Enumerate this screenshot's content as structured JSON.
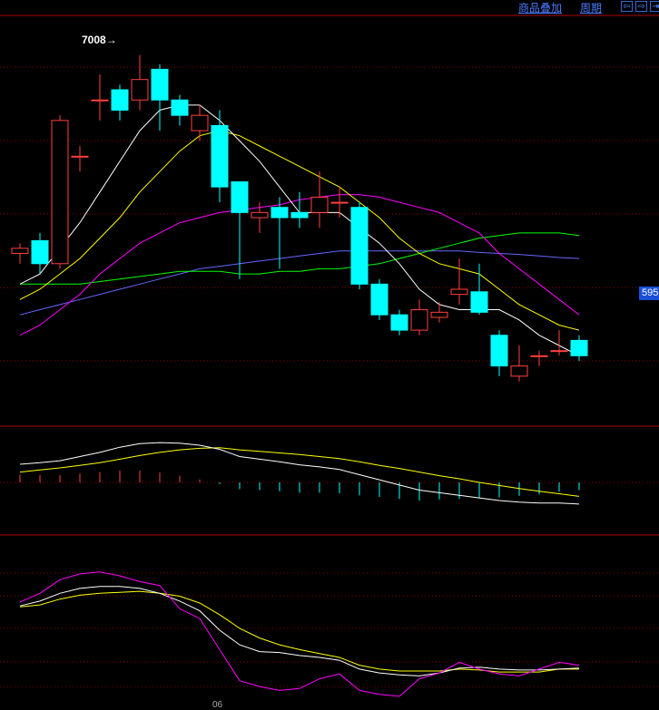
{
  "toolbar": {
    "overlay_label": "商品叠加",
    "period_label": "周期",
    "nav_prev": "⇦",
    "nav_next": "⇨",
    "nav_end": "⇥"
  },
  "price_tag": "595",
  "high_marker": "7008→",
  "x_tick": "06",
  "colors": {
    "up": "#ff4040",
    "down": "#00ffff",
    "ma5": "#ffffff",
    "ma10": "#ffff00",
    "ma20": "#ff00ff",
    "ma60": "#00ff00",
    "ma120": "#6666ff",
    "grid": "#8b0000",
    "border": "#b00000"
  },
  "chart_data": [
    {
      "type": "candlestick",
      "panel": "price",
      "candles": [
        {
          "o": 6620,
          "c": 6630,
          "h": 6640,
          "l": 6600
        },
        {
          "o": 6645,
          "c": 6600,
          "h": 6660,
          "l": 6580
        },
        {
          "o": 6600,
          "c": 6880,
          "h": 6890,
          "l": 6590
        },
        {
          "o": 6810,
          "c": 6810,
          "h": 6830,
          "l": 6780
        },
        {
          "o": 6920,
          "c": 6920,
          "h": 6970,
          "l": 6880
        },
        {
          "o": 6940,
          "c": 6900,
          "h": 6950,
          "l": 6880
        },
        {
          "o": 6920,
          "c": 6960,
          "h": 7008,
          "l": 6900
        },
        {
          "o": 6980,
          "c": 6920,
          "h": 6990,
          "l": 6860
        },
        {
          "o": 6920,
          "c": 6890,
          "h": 6930,
          "l": 6870
        },
        {
          "o": 6860,
          "c": 6890,
          "h": 6910,
          "l": 6840
        },
        {
          "o": 6870,
          "c": 6750,
          "h": 6900,
          "l": 6720
        },
        {
          "o": 6760,
          "c": 6700,
          "h": 6760,
          "l": 6570
        },
        {
          "o": 6690,
          "c": 6700,
          "h": 6720,
          "l": 6660
        },
        {
          "o": 6710,
          "c": 6690,
          "h": 6730,
          "l": 6590
        },
        {
          "o": 6700,
          "c": 6690,
          "h": 6740,
          "l": 6670
        },
        {
          "o": 6700,
          "c": 6730,
          "h": 6780,
          "l": 6670
        },
        {
          "o": 6720,
          "c": 6720,
          "h": 6750,
          "l": 6690
        },
        {
          "o": 6710,
          "c": 6560,
          "h": 6720,
          "l": 6550
        },
        {
          "o": 6560,
          "c": 6500,
          "h": 6570,
          "l": 6490
        },
        {
          "o": 6500,
          "c": 6470,
          "h": 6510,
          "l": 6460
        },
        {
          "o": 6470,
          "c": 6510,
          "h": 6530,
          "l": 6460
        },
        {
          "o": 6495,
          "c": 6505,
          "h": 6525,
          "l": 6485
        },
        {
          "o": 6540,
          "c": 6550,
          "h": 6610,
          "l": 6520
        },
        {
          "o": 6545,
          "c": 6505,
          "h": 6600,
          "l": 6500
        },
        {
          "o": 6460,
          "c": 6400,
          "h": 6470,
          "l": 6380
        },
        {
          "o": 6380,
          "c": 6400,
          "h": 6440,
          "l": 6370
        },
        {
          "o": 6420,
          "c": 6420,
          "h": 6430,
          "l": 6400
        },
        {
          "o": 6430,
          "c": 6430,
          "h": 6470,
          "l": 6420
        },
        {
          "o": 6450,
          "c": 6420,
          "h": 6460,
          "l": 6410
        }
      ],
      "ma5": [
        6560,
        6580,
        6630,
        6680,
        6740,
        6800,
        6860,
        6900,
        6910,
        6910,
        6880,
        6840,
        6800,
        6750,
        6700,
        6700,
        6700,
        6670,
        6640,
        6600,
        6550,
        6520,
        6510,
        6510,
        6510,
        6490,
        6460,
        6440,
        6420
      ],
      "ma10": [
        6530,
        6550,
        6580,
        6610,
        6650,
        6690,
        6740,
        6780,
        6820,
        6850,
        6860,
        6850,
        6830,
        6810,
        6790,
        6770,
        6750,
        6720,
        6690,
        6650,
        6620,
        6600,
        6590,
        6580,
        6550,
        6520,
        6500,
        6480,
        6470
      ],
      "ma20": [
        6460,
        6480,
        6510,
        6540,
        6580,
        6610,
        6640,
        6660,
        6680,
        6690,
        6700,
        6705,
        6710,
        6715,
        6725,
        6730,
        6735,
        6735,
        6730,
        6720,
        6710,
        6700,
        6680,
        6660,
        6620,
        6590,
        6560,
        6530,
        6500
      ],
      "ma60": [
        6560,
        6560,
        6560,
        6560,
        6565,
        6570,
        6575,
        6580,
        6585,
        6585,
        6585,
        6580,
        6580,
        6585,
        6585,
        6590,
        6590,
        6595,
        6600,
        6610,
        6620,
        6630,
        6640,
        6650,
        6655,
        6660,
        6660,
        6660,
        6655
      ],
      "ma120": [
        6500,
        6510,
        6520,
        6530,
        6540,
        6550,
        6560,
        6570,
        6580,
        6590,
        6595,
        6600,
        6605,
        6610,
        6615,
        6620,
        6625,
        6625,
        6625,
        6625,
        6625,
        6625,
        6625,
        6622,
        6620,
        6618,
        6615,
        6612,
        6610
      ],
      "ylim": [
        6300,
        7080
      ],
      "price_tag_value": 595,
      "high_value": 7008
    },
    {
      "type": "macd",
      "panel": "macd",
      "dif": [
        35,
        38,
        42,
        50,
        58,
        68,
        75,
        77,
        76,
        72,
        64,
        50,
        45,
        40,
        34,
        30,
        25,
        15,
        5,
        -5,
        -15,
        -20,
        -25,
        -30,
        -35,
        -38,
        -40,
        -40,
        -42
      ],
      "dea": [
        20,
        24,
        28,
        33,
        38,
        45,
        52,
        58,
        63,
        66,
        67,
        63,
        60,
        57,
        54,
        50,
        46,
        40,
        33,
        27,
        20,
        13,
        7,
        0,
        -6,
        -12,
        -17,
        -22,
        -27
      ],
      "hist": [
        15,
        14,
        14,
        17,
        20,
        23,
        23,
        19,
        13,
        6,
        -3,
        -13,
        -15,
        -17,
        -20,
        -20,
        -21,
        -25,
        -28,
        -32,
        -35,
        -33,
        -32,
        -30,
        -29,
        -26,
        -23,
        -18,
        -15
      ],
      "ylim": [
        -100,
        100
      ]
    },
    {
      "type": "kdj",
      "panel": "kdj",
      "k": [
        75,
        80,
        88,
        93,
        95,
        95,
        93,
        88,
        80,
        70,
        50,
        35,
        28,
        27,
        24,
        22,
        19,
        10,
        6,
        4,
        3,
        6,
        11,
        12,
        10,
        9,
        9,
        10,
        11
      ],
      "d": [
        74,
        76,
        82,
        86,
        88,
        89,
        90,
        88,
        85,
        78,
        66,
        52,
        42,
        35,
        30,
        26,
        22,
        14,
        10,
        8,
        8,
        8,
        10,
        9,
        7,
        7,
        7,
        10,
        10
      ],
      "j": [
        79,
        88,
        102,
        108,
        110,
        106,
        100,
        96,
        72,
        62,
        30,
        -2,
        -8,
        -12,
        -10,
        0,
        5,
        -12,
        -16,
        -18,
        0,
        6,
        17,
        10,
        5,
        3,
        10,
        17,
        14
      ],
      "ylim": [
        -20,
        120
      ]
    }
  ]
}
